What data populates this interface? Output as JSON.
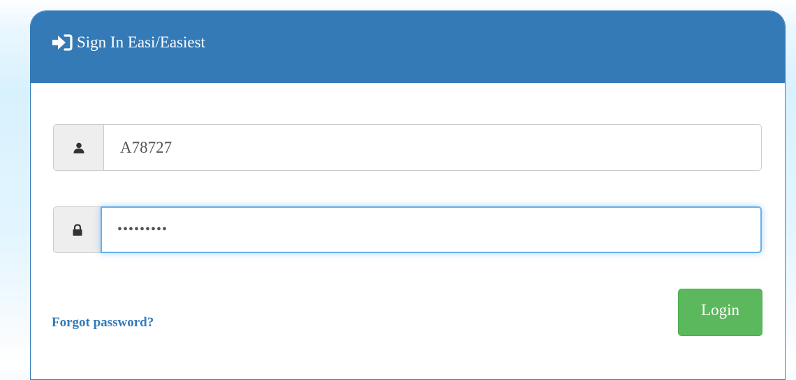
{
  "panel": {
    "title": "Sign In Easi/Easiest",
    "title_icon": "sign-in-icon"
  },
  "username": {
    "icon": "user-icon",
    "value": "A78727"
  },
  "password": {
    "icon": "lock-icon",
    "value": "•••••••••",
    "focused": true
  },
  "links": {
    "forgot_password": "Forgot password?"
  },
  "buttons": {
    "login": "Login"
  },
  "colors": {
    "primary": "#337ab7",
    "success": "#5cb85c",
    "focus": "#66afe9"
  }
}
